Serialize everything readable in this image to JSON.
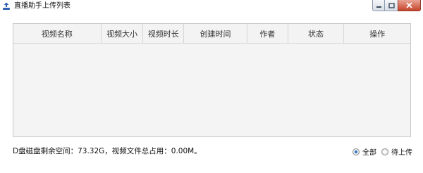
{
  "window": {
    "title": "直播助手上传列表",
    "icons": {
      "app": "app-icon",
      "minimize": "minimize-icon",
      "maximize": "maximize-icon",
      "close": "close-icon"
    }
  },
  "table": {
    "columns": [
      "视频名称",
      "视频大小",
      "视频时长",
      "创建时间",
      "作者",
      "状态",
      "操作"
    ],
    "rows": []
  },
  "status": {
    "text": "D盘磁盘剩余空间：73.32G，视频文件总占用：0.00M。"
  },
  "filters": {
    "all_label": "全部",
    "pending_label": "待上传",
    "selected": "all"
  },
  "colors": {
    "accent": "#2a6fc0",
    "close_button": "#c7432b"
  }
}
